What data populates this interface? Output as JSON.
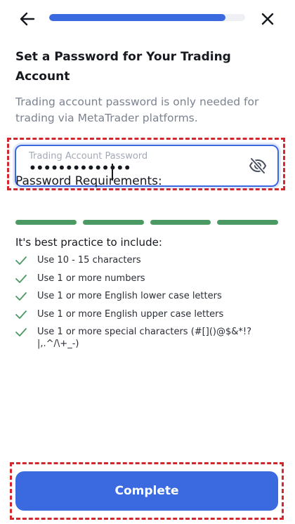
{
  "header": {
    "back_icon": "arrow-left-icon",
    "close_icon": "close-icon",
    "progress_fraction": 0.9,
    "progress_color": "#3b6ae0"
  },
  "title": "Set a Password for Your Trading Account",
  "description": "Trading account password is only needed for trading via MetaTrader platforms.",
  "password_field": {
    "label": "Trading Account Password",
    "value_masked": "••••••••••••••",
    "visibility_icon": "eye-off-icon",
    "border_color": "#3b6ae0"
  },
  "requirements": {
    "heading": "Password Requirements:",
    "strength_segments_filled": 4,
    "strength_segments_total": 4,
    "strength_color": "#4b9a64",
    "subheading": "It's best practice to include:",
    "items": [
      {
        "label": "Use 10 - 15 characters",
        "met": true
      },
      {
        "label": "Use 1 or more numbers",
        "met": true
      },
      {
        "label": "Use 1 or more English lower case letters",
        "met": true
      },
      {
        "label": "Use 1 or more English upper case letters",
        "met": true
      },
      {
        "label": "Use 1 or more special characters (#[]()@$&*!?|,.^/\\+_-)",
        "met": true
      }
    ],
    "check_icon": "check-icon"
  },
  "complete_button": {
    "label": "Complete",
    "color": "#3b6ae0"
  },
  "highlight_color": "#d2282d"
}
